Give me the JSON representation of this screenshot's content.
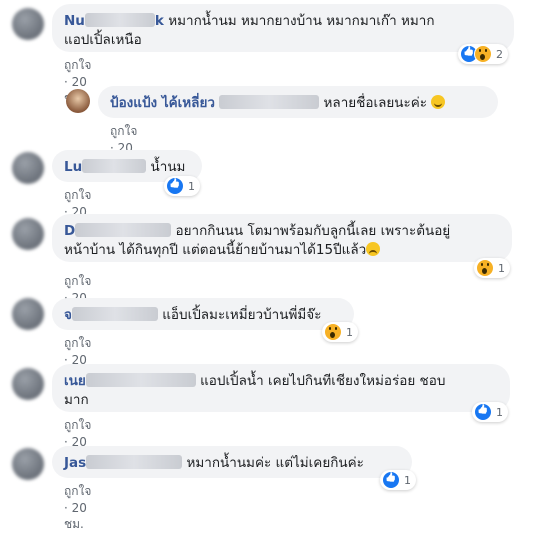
{
  "comments": [
    {
      "name": "Nu",
      "name_tail": "k",
      "text": "หมากน้ำนม หมากยางบ้าน หมากมาเก๊า หมาก",
      "text2": "แอปเปิ้ลเหนือ",
      "like": "ถูกใจ",
      "time": "20 ชม.",
      "reactions": [
        "like-icon",
        "wow-icon"
      ],
      "count": "2"
    },
    {
      "name": "ป้องแป้ง ไค้เหลี่ยว",
      "text": "หลายชื่อเลยนะค่ะ",
      "emoji": "smile-emoji",
      "like": "ถูกใจ",
      "time": "20 ชม."
    },
    {
      "name": "Lu",
      "text": "น้ำนม",
      "like": "ถูกใจ",
      "time": "20 ชม.",
      "reactions": [
        "like-icon"
      ],
      "count": "1"
    },
    {
      "name": "D",
      "text": "อยากกินนน โตมาพร้อมกับลูกนี้เลย เพราะต้นอยู่",
      "text2": "หน้าบ้าน ได้กินทุกปี แต่ตอนนี้ย้ายบ้านมาได้15ปีแล้ว",
      "emoji": "sad-emoji",
      "like": "ถูกใจ",
      "time": "20 ชม.",
      "reactions": [
        "wow-icon"
      ],
      "count": "1"
    },
    {
      "name": "จ",
      "text": "แอ็บเปิ้ลมะเหมี่ยวบ้านพี่มีจ๊ะ",
      "like": "ถูกใจ",
      "time": "20 ชม.",
      "reactions": [
        "wow-icon"
      ],
      "count": "1"
    },
    {
      "name": "เนย",
      "text": "แอปเปิ้ลน้ำ เคยไปกินทีเชียงใหม่อร่อย ชอบ",
      "text2": "มาก",
      "like": "ถูกใจ",
      "time": "20 ชม.",
      "reactions": [
        "like-icon"
      ],
      "count": "1"
    },
    {
      "name": "Jas",
      "text": "หมากน้ำนมค่ะ แต่ไม่เคยกินค่ะ",
      "like": "ถูกใจ",
      "time": "20 ชม.",
      "reactions": [
        "like-icon"
      ],
      "count": "1"
    }
  ],
  "colors": {
    "name": "#385898",
    "bubble": "#f2f3f5",
    "meta": "#606770",
    "like": "#1877f2",
    "wow": "#f7b125"
  }
}
